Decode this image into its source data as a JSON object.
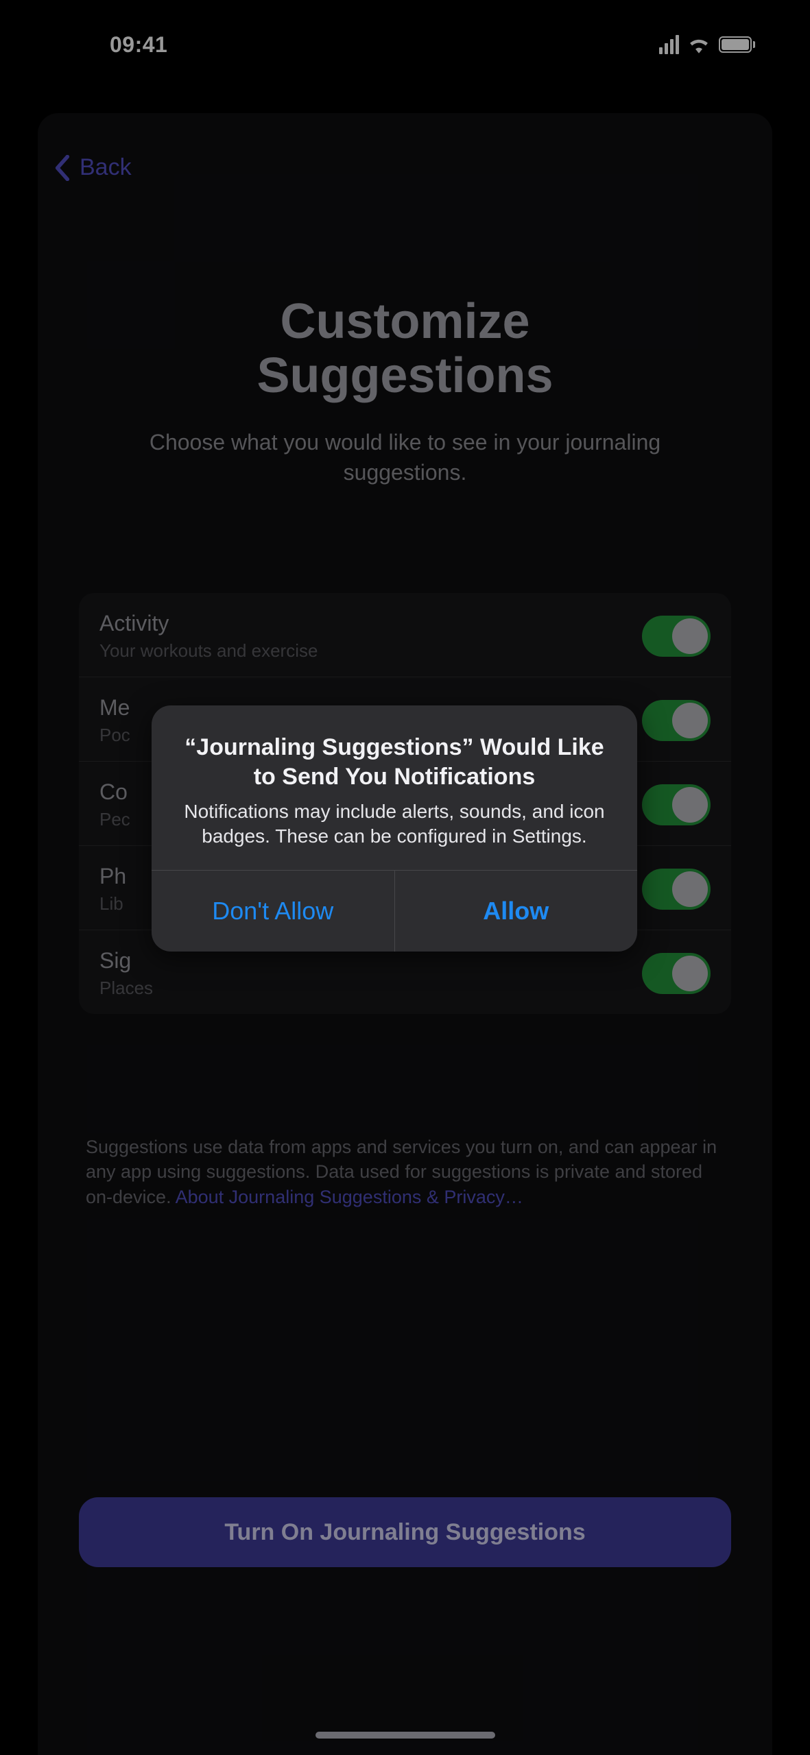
{
  "status": {
    "time": "09:41"
  },
  "nav": {
    "back_label": "Back"
  },
  "header": {
    "title_line1": "Customize",
    "title_line2": "Suggestions",
    "subtitle": "Choose what you would like to see in your journaling suggestions."
  },
  "settings": {
    "items": [
      {
        "title": "Activity",
        "subtitle": "Your workouts and exercise",
        "on": true
      },
      {
        "title": "Me",
        "subtitle": "Poc",
        "on": true
      },
      {
        "title": "Co",
        "subtitle": "Pec",
        "on": true
      },
      {
        "title": "Ph",
        "subtitle": "Lib",
        "on": true
      },
      {
        "title": "Sig",
        "subtitle": "Places",
        "on": true
      }
    ]
  },
  "disclaimer": {
    "text": "Suggestions use data from apps and services you turn on, and can appear in any app using suggestions. Data used for suggestions is private and stored on-device. ",
    "link_text": "About Journaling Suggestions & Privacy…"
  },
  "primary_button": {
    "label": "Turn On Journaling Suggestions"
  },
  "alert": {
    "title": "“Journaling Suggestions” Would Like to Send You Notifications",
    "body": "Notifications may include alerts, sounds, and icon badges. These can be configured in Settings.",
    "dont_allow_label": "Don't Allow",
    "allow_label": "Allow"
  }
}
